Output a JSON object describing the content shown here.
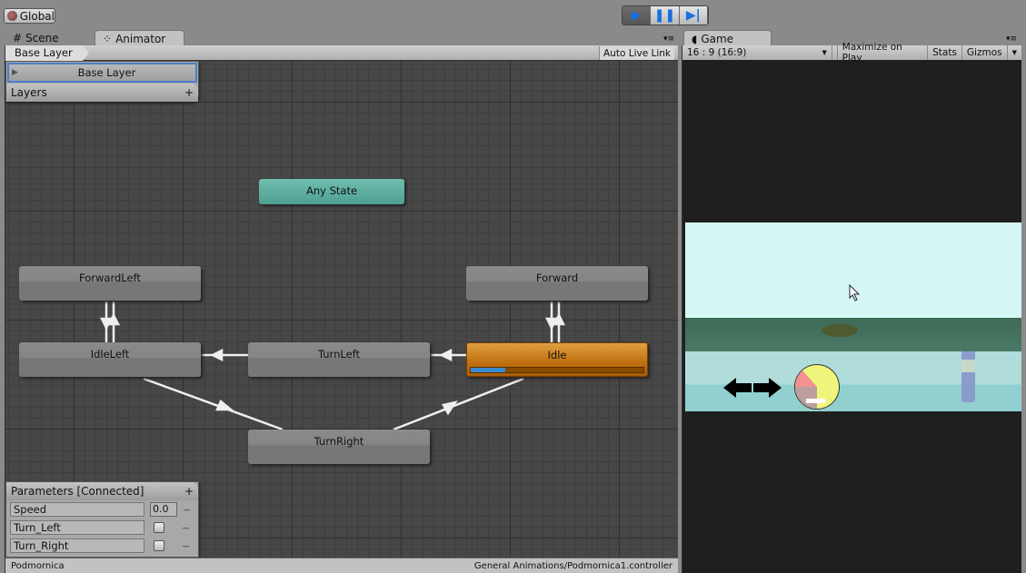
{
  "toolbar": {
    "global_label": "Global",
    "play_icons": [
      "play",
      "pause",
      "step"
    ]
  },
  "tabs": {
    "scene": "Scene",
    "animator": "Animator",
    "game": "Game"
  },
  "animator": {
    "breadcrumb": "Base Layer",
    "auto_live_link": "Auto Live Link",
    "layers": {
      "title": "Layers",
      "add": "+",
      "items": [
        {
          "label": "Base Layer"
        }
      ]
    },
    "states": {
      "any": "Any State",
      "forward_left": "ForwardLeft",
      "forward": "Forward",
      "idle_left": "IdleLeft",
      "turn_left": "TurnLeft",
      "idle": "Idle",
      "turn_right": "TurnRight"
    },
    "idle_progress": 0.2,
    "parameters": {
      "title": "Parameters [Connected]",
      "add": "+",
      "items": [
        {
          "name": "Speed",
          "value": "0.0"
        },
        {
          "name": "Turn_Left"
        },
        {
          "name": "Turn_Right"
        }
      ]
    },
    "status_left": "Podmornica",
    "status_right": "General Animations/Podmornica1.controller"
  },
  "game": {
    "aspect": "16 : 9 (16:9)",
    "maximize": "Maximize on Play",
    "stats": "Stats",
    "gizmos": "Gizmos"
  }
}
